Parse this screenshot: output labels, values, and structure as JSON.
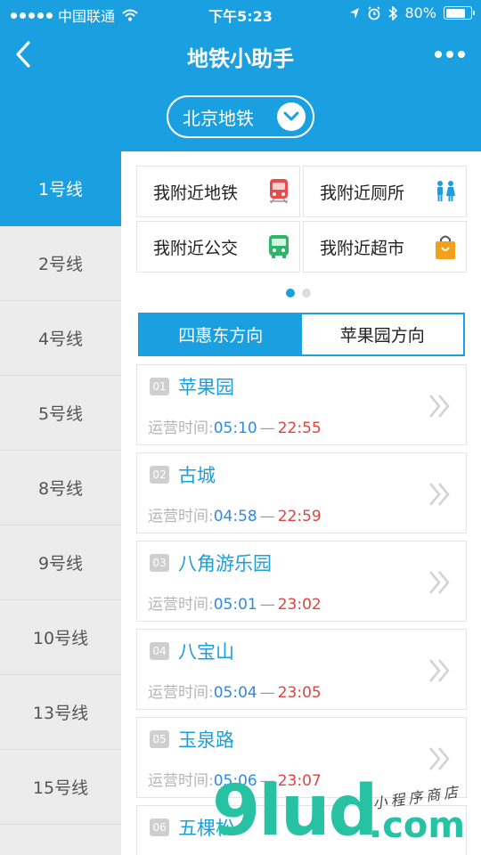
{
  "status_bar": {
    "carrier": "中国联通",
    "time": "下午5:23",
    "battery": "80%",
    "battery_level": 0.8
  },
  "nav": {
    "title": "地铁小助手"
  },
  "city_selector": {
    "label": "北京地铁"
  },
  "lines": [
    {
      "label": "1号线",
      "active": true
    },
    {
      "label": "2号线"
    },
    {
      "label": "4号线"
    },
    {
      "label": "5号线"
    },
    {
      "label": "8号线"
    },
    {
      "label": "9号线"
    },
    {
      "label": "10号线"
    },
    {
      "label": "13号线"
    },
    {
      "label": "15号线"
    }
  ],
  "quick_links": [
    {
      "label": "我附近地铁",
      "icon": "subway-train-icon"
    },
    {
      "label": "我附近厕所",
      "icon": "restroom-icon"
    },
    {
      "label": "我附近公交",
      "icon": "bus-icon"
    },
    {
      "label": "我附近超市",
      "icon": "shopping-bag-icon"
    }
  ],
  "direction_tabs": [
    {
      "label": "四惠东方向",
      "active": true
    },
    {
      "label": "苹果园方向"
    }
  ],
  "station_hours_label": "运营时间:",
  "stations": [
    {
      "num": "01",
      "name": "苹果园",
      "open": "05:10",
      "close": "22:55"
    },
    {
      "num": "02",
      "name": "古城",
      "open": "04:58",
      "close": "22:59"
    },
    {
      "num": "03",
      "name": "八角游乐园",
      "open": "05:01",
      "close": "23:02"
    },
    {
      "num": "04",
      "name": "八宝山",
      "open": "05:04",
      "close": "23:05"
    },
    {
      "num": "05",
      "name": "玉泉路",
      "open": "05:06",
      "close": "23:07"
    },
    {
      "num": "06",
      "name": "五棵松",
      "open": "",
      "close": ""
    }
  ],
  "watermark": {
    "big": "9lud",
    "com": ".com",
    "small": "小程序商店"
  },
  "colors": {
    "primary": "#1aa0e0",
    "open_time": "#2e8be0",
    "close_time": "#e0433e"
  }
}
